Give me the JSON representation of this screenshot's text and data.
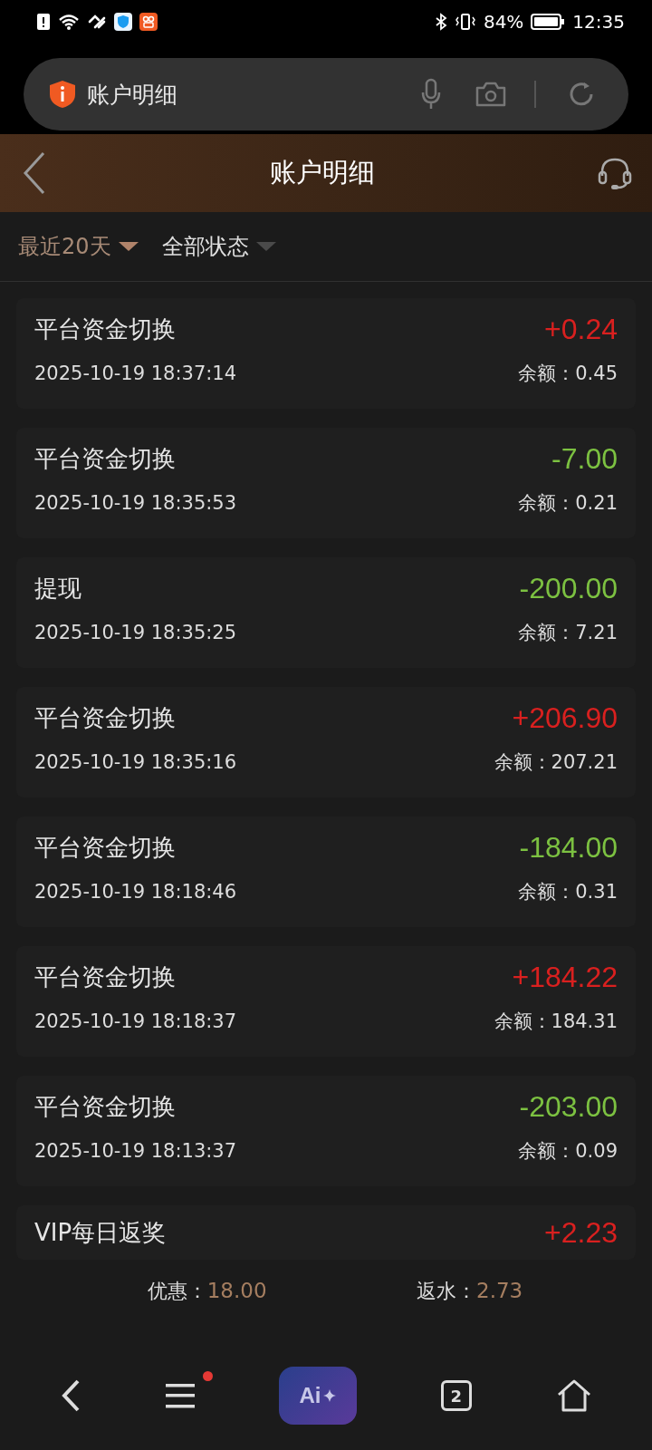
{
  "status_bar": {
    "battery": "84%",
    "time": "12:35"
  },
  "address_bar": {
    "title": "账户明细"
  },
  "header": {
    "title": "账户明细"
  },
  "filters": [
    {
      "label": "最近20天",
      "selected": true
    },
    {
      "label": "全部状态",
      "selected": false
    }
  ],
  "records": [
    {
      "title": "平台资金切换",
      "amount": "+0.24",
      "color": "#d9201f",
      "time": "2025-10-19 18:37:14",
      "balance_label": "余额：",
      "balance": "0.45"
    },
    {
      "title": "平台资金切换",
      "amount": "-7.00",
      "color": "#7cc141",
      "time": "2025-10-19 18:35:53",
      "balance_label": "余额：",
      "balance": "0.21"
    },
    {
      "title": "提现",
      "amount": "-200.00",
      "color": "#7cc141",
      "time": "2025-10-19 18:35:25",
      "balance_label": "余额：",
      "balance": "7.21"
    },
    {
      "title": "平台资金切换",
      "amount": "+206.90",
      "color": "#d9201f",
      "time": "2025-10-19 18:35:16",
      "balance_label": "余额：",
      "balance": "207.21"
    },
    {
      "title": "平台资金切换",
      "amount": "-184.00",
      "color": "#7cc141",
      "time": "2025-10-19 18:18:46",
      "balance_label": "余额：",
      "balance": "0.31"
    },
    {
      "title": "平台资金切换",
      "amount": "+184.22",
      "color": "#d9201f",
      "time": "2025-10-19 18:18:37",
      "balance_label": "余额：",
      "balance": "184.31"
    },
    {
      "title": "平台资金切换",
      "amount": "-203.00",
      "color": "#7cc141",
      "time": "2025-10-19 18:13:37",
      "balance_label": "余额：",
      "balance": "0.09"
    },
    {
      "title": "VIP每日返奖",
      "amount": "+2.23",
      "color": "#d9201f"
    }
  ],
  "summary": [
    {
      "label": "优惠：",
      "value": "18.00"
    },
    {
      "label": "返水：",
      "value": "2.73"
    }
  ],
  "nav_bar": {
    "ai_label": "Ai",
    "tab_count": "2",
    "menu_badge": true
  }
}
